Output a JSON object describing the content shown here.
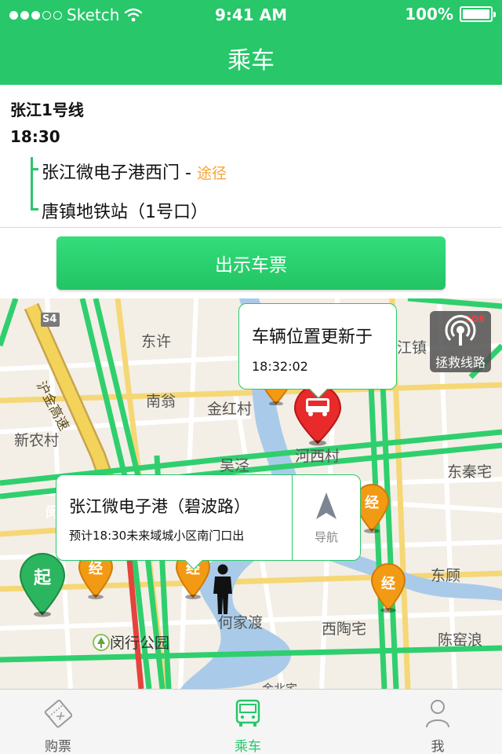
{
  "status_bar": {
    "carrier": "Sketch",
    "time": "9:41 AM",
    "battery": "100%"
  },
  "nav": {
    "title": "乘车"
  },
  "route": {
    "line_name": "张江1号线",
    "departure_time": "18:30",
    "stops": [
      {
        "name": "张江微电子港西门 - ",
        "via_label": "途径"
      },
      {
        "name": "唐镇地铁站（1号口）"
      }
    ]
  },
  "show_ticket_button": {
    "label": "出示车票"
  },
  "map": {
    "places": [
      "东许",
      "南翁",
      "金红村",
      "新农村",
      "吴泾",
      "河西村",
      "东秦宅",
      "江镇",
      "东顾",
      "何家渡",
      "西陶宅",
      "陈窑浪",
      "闵行公园",
      "金北宅"
    ],
    "road_labels": [
      "S4",
      "沪金高速",
      "闵"
    ],
    "pin_labels": {
      "start": "起",
      "waypoint": "经"
    },
    "sos_button": {
      "badge": "SOS",
      "label": "拯救线路"
    },
    "vehicle_bubble": {
      "title": "车辆位置更新于",
      "time": "18:32:02"
    },
    "station_bubble": {
      "title": "张江微电子港（碧波路）",
      "eta": "预计18:30未来域城小区南门口出",
      "nav_label": "导航"
    }
  },
  "tabs": [
    {
      "label": "购票",
      "icon": "ticket-icon",
      "active": false
    },
    {
      "label": "乘车",
      "icon": "bus-icon",
      "active": true
    },
    {
      "label": "我",
      "icon": "user-icon",
      "active": false
    }
  ],
  "colors": {
    "brand_green": "#27c76a",
    "via_orange": "#f4a63a",
    "waypoint_orange": "#f39a14",
    "vehicle_red": "#e82a2a"
  }
}
